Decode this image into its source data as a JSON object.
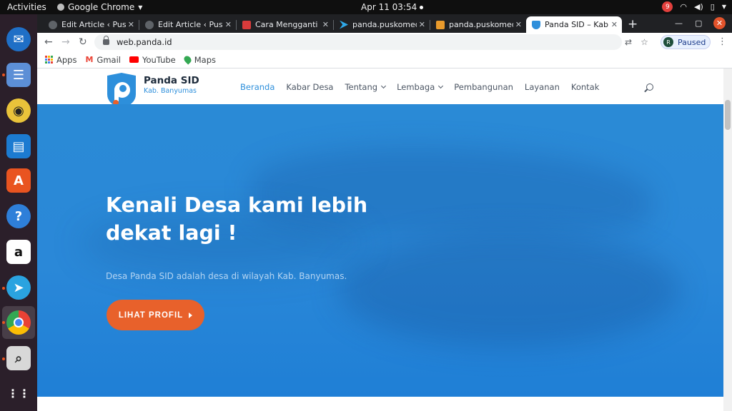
{
  "system_bar": {
    "activities": "Activities",
    "app_menu": "Google Chrome",
    "clock": "Apr 11  03:54",
    "notification_count": "9"
  },
  "tabs": [
    {
      "title": "Edit Article ‹ Pusk",
      "icon": "globe-icon",
      "active": false
    },
    {
      "title": "Edit Article ‹ Pusk",
      "icon": "globe-icon",
      "active": false
    },
    {
      "title": "Cara Mengganti",
      "icon": "owl-icon",
      "active": false
    },
    {
      "title": "panda.puskomed",
      "icon": "arrow-logo-icon",
      "active": false
    },
    {
      "title": "panda.puskomed",
      "icon": "folder-logo-icon",
      "active": false
    },
    {
      "title": "Panda SID – Kab.",
      "icon": "panda-shield-icon",
      "active": true
    }
  ],
  "address_bar": {
    "url": "web.panda.id"
  },
  "profile": {
    "initial": "R",
    "status": "Paused"
  },
  "bookmarks": [
    {
      "label": "Apps",
      "icon": "apps-grid-icon"
    },
    {
      "label": "Gmail",
      "icon": "gmail-icon"
    },
    {
      "label": "YouTube",
      "icon": "youtube-icon"
    },
    {
      "label": "Maps",
      "icon": "maps-pin-icon"
    }
  ],
  "site": {
    "brand": "Panda SID",
    "brand_sub": "Kab. Banyumas",
    "nav": [
      {
        "label": "Beranda",
        "active": true,
        "dropdown": false
      },
      {
        "label": "Kabar Desa",
        "active": false,
        "dropdown": false
      },
      {
        "label": "Tentang",
        "active": false,
        "dropdown": true
      },
      {
        "label": "Lembaga",
        "active": false,
        "dropdown": true
      },
      {
        "label": "Pembangunan",
        "active": false,
        "dropdown": false
      },
      {
        "label": "Layanan",
        "active": false,
        "dropdown": false
      },
      {
        "label": "Kontak",
        "active": false,
        "dropdown": false
      }
    ],
    "hero": {
      "heading": "Kenali Desa kami lebih dekat lagi !",
      "description": "Desa Panda SID adalah desa di wilayah Kab. Banyumas.",
      "cta_label": "LIHAT PROFIL"
    }
  },
  "colors": {
    "accent_blue": "#2d8fdb",
    "cta_orange": "#e8612b",
    "hero_blue": "#2a88d8",
    "dock_bg": "#2b1f2a"
  }
}
